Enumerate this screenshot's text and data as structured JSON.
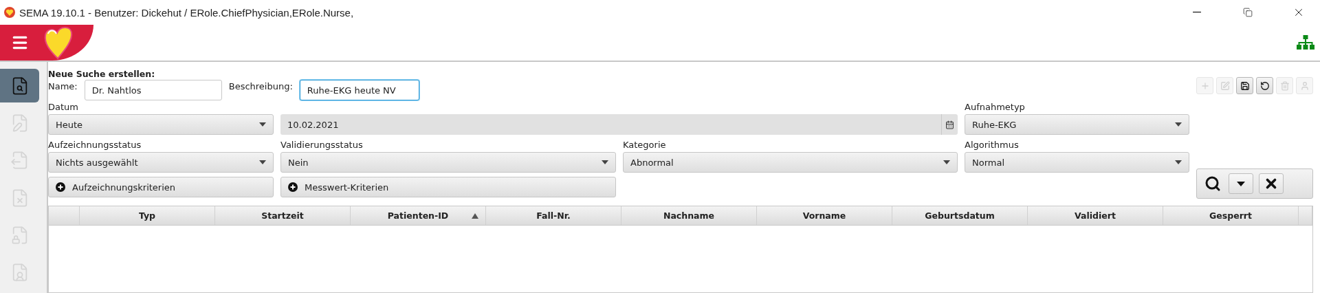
{
  "window": {
    "title": "SEMA 19.10.1 - Benutzer: Dickehut / ERole.ChiefPhysician,ERole.Nurse,"
  },
  "sidebar": {
    "items": [
      {
        "kind": "search",
        "selected": true,
        "disabled": false
      },
      {
        "kind": "edit",
        "selected": false,
        "disabled": true
      },
      {
        "kind": "export",
        "selected": false,
        "disabled": true
      },
      {
        "kind": "delete",
        "selected": false,
        "disabled": true
      },
      {
        "kind": "lock",
        "selected": false,
        "disabled": true
      },
      {
        "kind": "user",
        "selected": false,
        "disabled": true
      }
    ]
  },
  "search_form": {
    "heading": "Neue Suche erstellen:",
    "name": {
      "label": "Name:",
      "value": "Dr. Nahtlos",
      "focused": false
    },
    "description": {
      "label": "Beschreibung:",
      "value": "Ruhe-EKG heute NV",
      "focused": true
    },
    "toolbar": [
      {
        "kind": "add",
        "disabled": true
      },
      {
        "kind": "edit",
        "disabled": true
      },
      {
        "kind": "save",
        "disabled": false
      },
      {
        "kind": "undo",
        "disabled": false
      },
      {
        "kind": "delete",
        "disabled": true
      },
      {
        "kind": "user",
        "disabled": true
      }
    ],
    "fields": [
      {
        "kind": "select",
        "label": "Datum",
        "value": "Heute"
      },
      {
        "kind": "date",
        "value": "10.02.2021"
      },
      {
        "kind": "select",
        "label": "Aufnahmetyp",
        "value": "Ruhe-EKG"
      },
      {
        "kind": "select",
        "label": "Aufzeichnungsstatus",
        "value": "Nichts ausgewählt"
      },
      {
        "kind": "select",
        "label": "Validierungsstatus",
        "value": "Nein"
      },
      {
        "kind": "select",
        "label": "Kategorie",
        "value": "Abnormal"
      },
      {
        "kind": "select",
        "label": "Algorithmus",
        "value": "Normal"
      }
    ],
    "criteria_buttons": [
      {
        "label": "Aufzeichnungskriterien"
      },
      {
        "label": "Messwert-Kriterien"
      }
    ],
    "search_actions": [
      {
        "kind": "search"
      },
      {
        "kind": "dropdown"
      },
      {
        "kind": "clear"
      }
    ]
  },
  "table": {
    "columns": [
      {
        "label": "Typ",
        "sorted": false
      },
      {
        "label": "Startzeit",
        "sorted": false
      },
      {
        "label": "Patienten-ID",
        "sorted": true
      },
      {
        "label": "Fall-Nr.",
        "sorted": false
      },
      {
        "label": "Nachname",
        "sorted": false
      },
      {
        "label": "Vorname",
        "sorted": false
      },
      {
        "label": "Geburtsdatum",
        "sorted": false
      },
      {
        "label": "Validiert",
        "sorted": false
      },
      {
        "label": "Gesperrt",
        "sorted": false
      }
    ]
  }
}
